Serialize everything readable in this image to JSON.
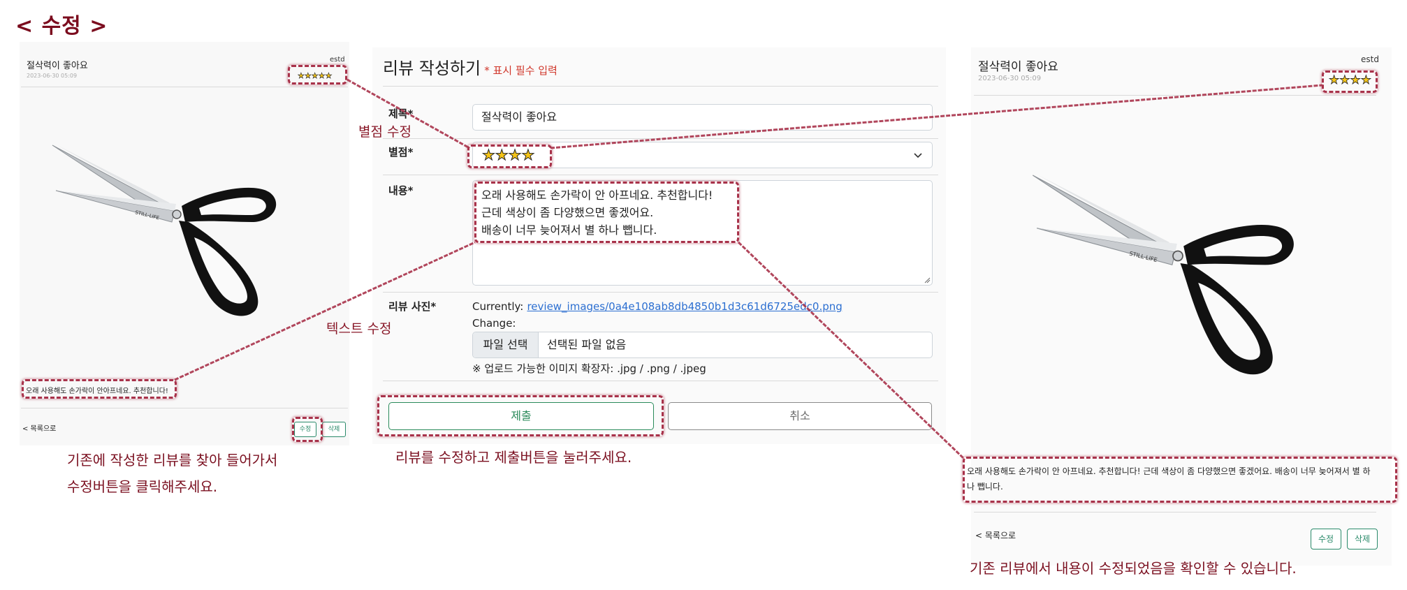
{
  "page_heading": "< 수정 >",
  "left_panel": {
    "title": "절삭력이 좋아요",
    "date": "2023-06-30 05:09",
    "user": "estd",
    "stars": "★★★★★",
    "review_text": "오래 사용해도 손가락이 안아프네요. 추천합니다!",
    "back_link": "< 목록으로",
    "edit_button": "수정",
    "delete_button": "삭제",
    "image_icon": "scissors-image"
  },
  "form": {
    "title": "리뷰 작성하기",
    "required_note": "* 표시 필수 입력",
    "subject_label": "제목*",
    "subject_value": "절삭력이 좋아요",
    "rating_label": "별점*",
    "rating_value": "★★★★",
    "content_label": "내용*",
    "content_value": "오래 사용해도 손가락이 안 아프네요. 추천합니다!\n근데 색상이 좀 다양했으면 좋겠어요.\n배송이 너무 늦어져서 별 하나 뺍니다.",
    "photo_label": "리뷰 사진*",
    "currently_label": "Currently:",
    "currently_link": "review_images/0a4e108ab8db4850b1d3c61d6725edc0.png",
    "change_label": "Change:",
    "file_button": "파일 선택",
    "file_status": "선택된 파일 없음",
    "file_hint": "※ 업로드 가능한 이미지 확장자: .jpg / .png / .jpeg",
    "submit_button": "제출",
    "cancel_button": "취소"
  },
  "right_panel": {
    "title": "절삭력이 좋아요",
    "date": "2023-06-30 05:09",
    "user": "estd",
    "stars": "★★★★",
    "review_text": "오래 사용해도 손가락이 안 아프네요. 추천합니다! 근데 색상이 좀 다양했으면 좋겠어요. 배송이 너무 늦어져서 별 하나 뺍니다.",
    "back_link": "< 목록으로",
    "edit_button": "수정",
    "delete_button": "삭제"
  },
  "annotations": {
    "star_edit": "별점 수정",
    "text_edit": "텍스트 수정"
  },
  "captions": {
    "left_line1": "기존에 작성한 리뷰를 찾아 들어가서",
    "left_line2": "수정버튼을 클릭해주세요.",
    "center": "리뷰를 수정하고 제출버튼을 눌러주세요.",
    "right": "기존 리뷰에서 내용이 수정되었음을 확인할 수 있습니다."
  },
  "colors": {
    "accent": "#7b0c1e",
    "highlight": "#a8324a",
    "button_green": "#2a8a5a",
    "link_blue": "#2c6fd1",
    "star_yellow": "#f5c518"
  }
}
